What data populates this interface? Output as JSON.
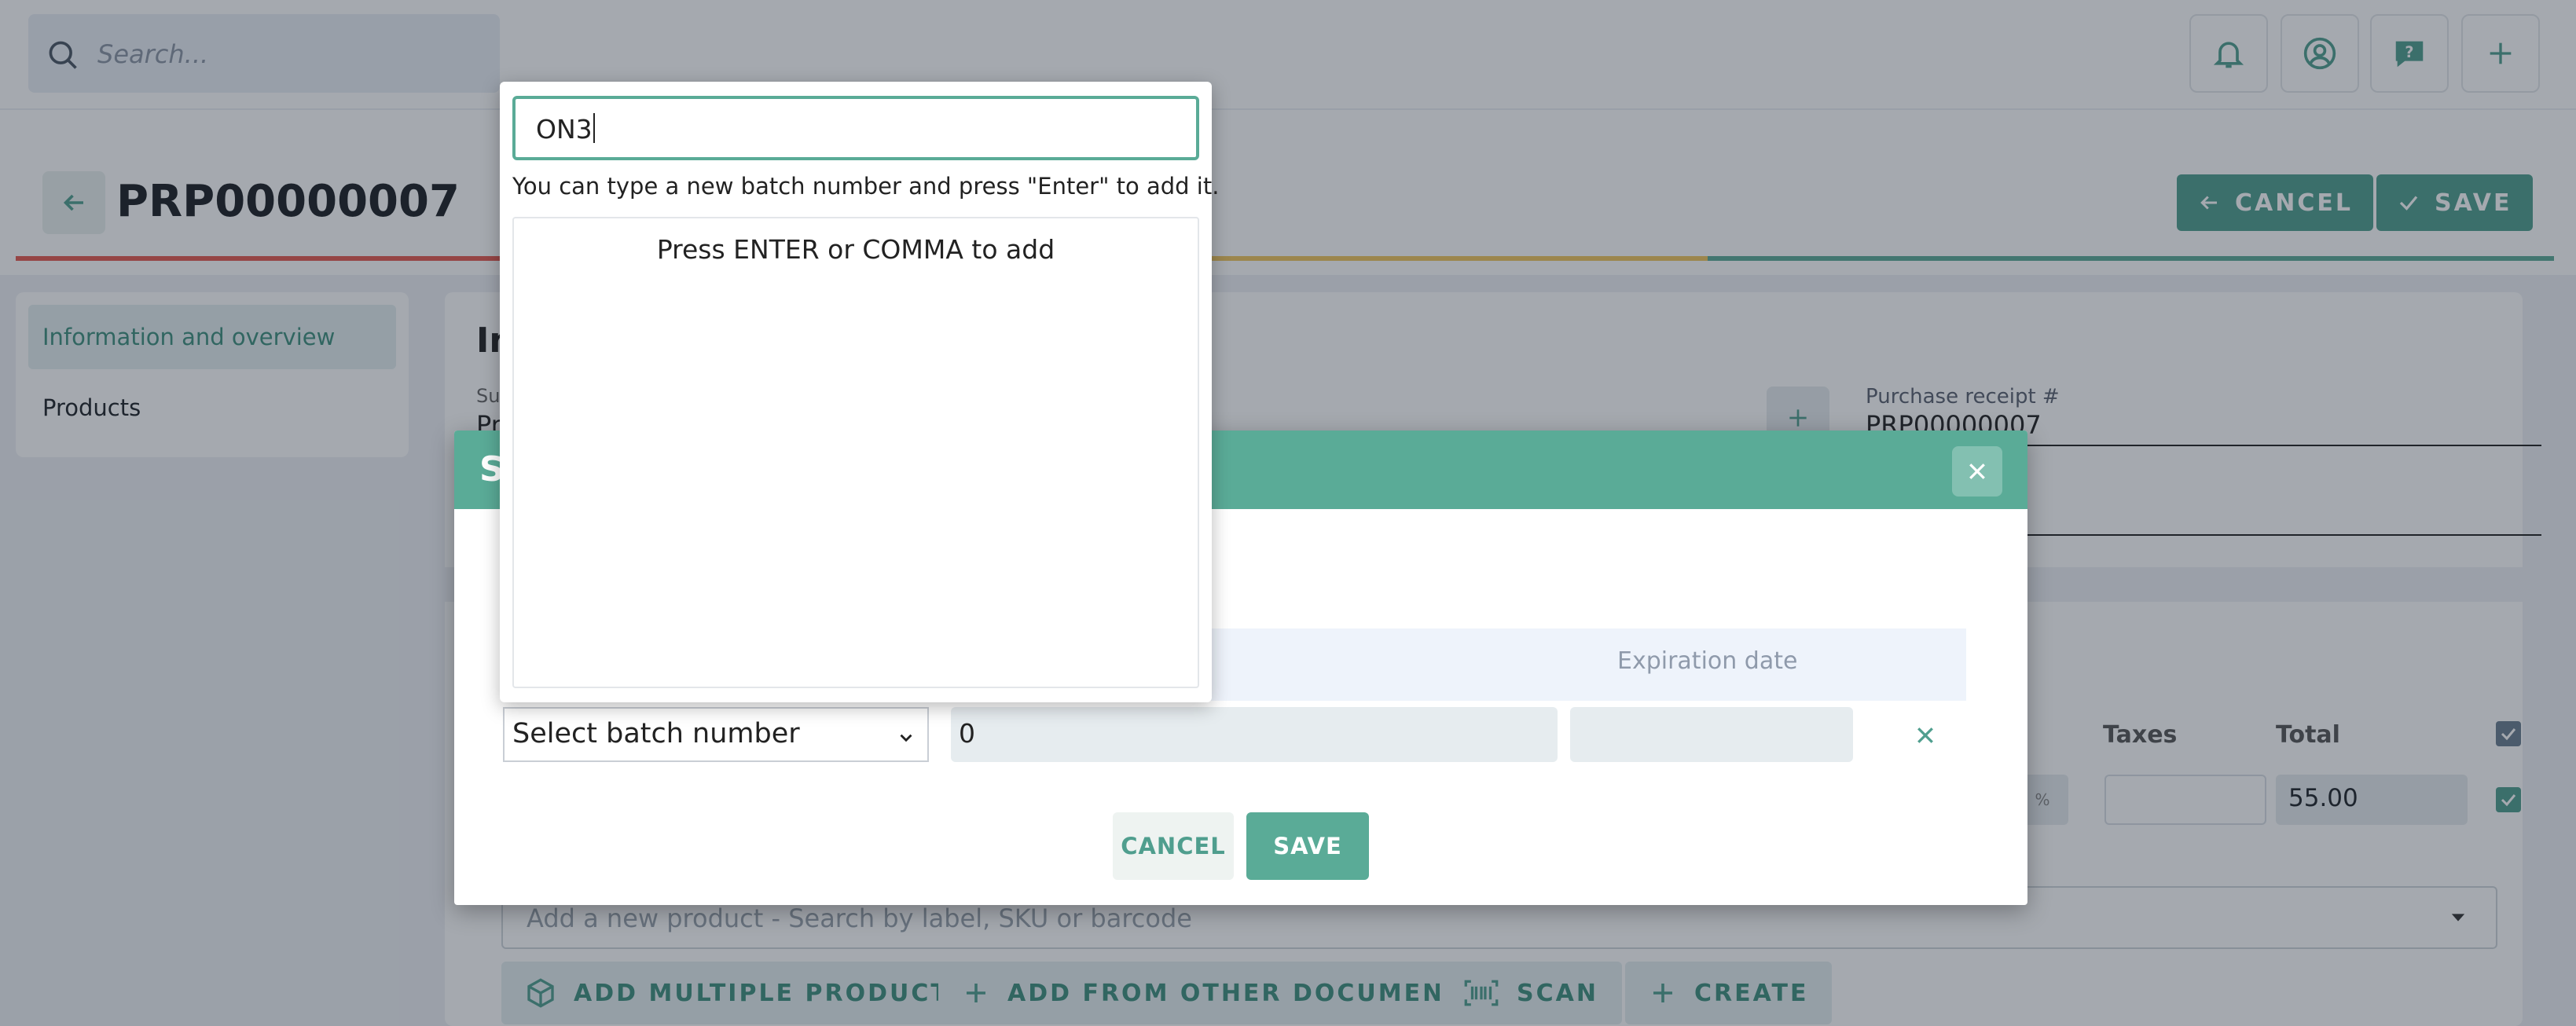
{
  "topbar": {
    "search_placeholder": "Search..."
  },
  "header": {
    "title": "PRP00000007",
    "cancel_label": "CANCEL",
    "save_label": "SAVE",
    "progress_colors": [
      "#e5594f",
      "#f1c55d",
      "#5aab97"
    ]
  },
  "sidebar": {
    "items": [
      {
        "label": "Information and overview"
      },
      {
        "label": "Products"
      }
    ]
  },
  "main": {
    "info_title": "In",
    "supplier_label": "Su",
    "supplier_value": "Pr",
    "purchase_receipt_label": "Purchase receipt #",
    "purchase_receipt_value": "PRP00000007",
    "col_taxes": "Taxes",
    "col_total": "Total",
    "pct_symbol": "%",
    "total_value": "55.00",
    "add_product_placeholder": "Add a new product - Search by label, SKU or barcode",
    "buttons": {
      "add_multiple": "ADD MULTIPLE PRODUCTS",
      "add_from_other": "ADD FROM OTHER DOCUMENTS",
      "scan": "SCAN",
      "create": "CREATE"
    }
  },
  "modal": {
    "title_visible": "S",
    "col_expiration": "Expiration date",
    "batch_select_value": "Select batch number",
    "quantity_value": "0",
    "cancel_label": "CANCEL",
    "save_label": "SAVE"
  },
  "popup": {
    "input_value": "ON3",
    "hint": "You can type a new batch number and press \"Enter\" to add it.",
    "empty_message": "Press ENTER or COMMA to add"
  },
  "colors": {
    "accent": "#5aab97",
    "accent_dark": "#4f9e8e",
    "overlay": "rgba(30,40,55,0.40)"
  }
}
